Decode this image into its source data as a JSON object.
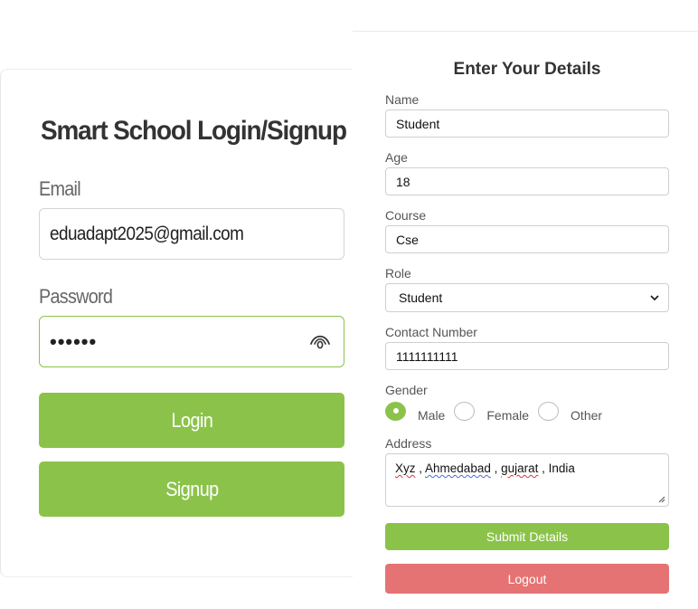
{
  "login": {
    "title": "Smart School Login/Signup",
    "email_label": "Email",
    "email_value": "eduadapt2025@gmail.com",
    "password_label": "Password",
    "password_masked": "••••••",
    "login_button": "Login",
    "signup_button": "Signup",
    "icons": {
      "toggle_password": "eye-icon"
    },
    "colors": {
      "accent": "#8bc34a",
      "focus_border": "#8bc34a"
    }
  },
  "details": {
    "title": "Enter Your Details",
    "name_label": "Name",
    "name_value": "Student",
    "age_label": "Age",
    "age_value": "18",
    "course_label": "Course",
    "course_value": "Cse",
    "role_label": "Role",
    "role_value": "Student",
    "contact_label": "Contact Number",
    "contact_value": "1111111111",
    "gender_label": "Gender",
    "gender_options": [
      {
        "label": "Male",
        "selected": true
      },
      {
        "label": "Female",
        "selected": false
      },
      {
        "label": "Other",
        "selected": false
      }
    ],
    "address_label": "Address",
    "address_parts": [
      "Xyz",
      " , ",
      "Ahmedabad",
      " , ",
      "gujarat",
      " , India"
    ],
    "submit_button": "Submit Details",
    "logout_button": "Logout",
    "colors": {
      "submit": "#8bc34a",
      "logout": "#e57373"
    }
  }
}
